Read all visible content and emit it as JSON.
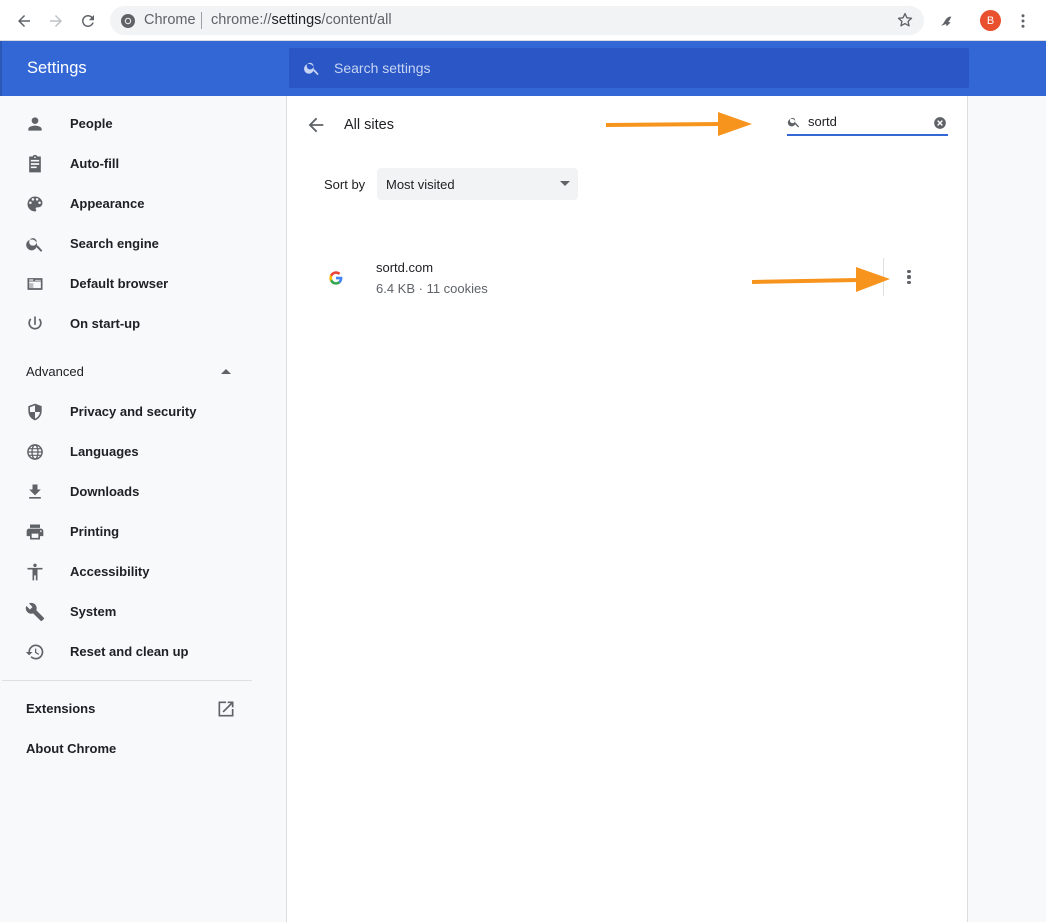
{
  "browser": {
    "omnibox_prefix": "Chrome",
    "url_scheme": "chrome://",
    "url_host": "settings",
    "url_path": "/content/all",
    "profile_initial": "B",
    "profile_color": "#e8502e"
  },
  "header": {
    "title": "Settings",
    "search_placeholder": "Search settings",
    "color": "#3367d6"
  },
  "sidebar": {
    "items": [
      {
        "label": "People",
        "icon": "person-icon"
      },
      {
        "label": "Auto-fill",
        "icon": "clipboard-icon"
      },
      {
        "label": "Appearance",
        "icon": "palette-icon"
      },
      {
        "label": "Search engine",
        "icon": "search-icon"
      },
      {
        "label": "Default browser",
        "icon": "browser-window-icon"
      },
      {
        "label": "On start-up",
        "icon": "power-icon"
      }
    ],
    "advanced_label": "Advanced",
    "advanced_items": [
      {
        "label": "Privacy and security",
        "icon": "shield-icon"
      },
      {
        "label": "Languages",
        "icon": "globe-icon"
      },
      {
        "label": "Downloads",
        "icon": "download-icon"
      },
      {
        "label": "Printing",
        "icon": "printer-icon"
      },
      {
        "label": "Accessibility",
        "icon": "accessibility-icon"
      },
      {
        "label": "System",
        "icon": "wrench-icon"
      },
      {
        "label": "Reset and clean up",
        "icon": "restore-icon"
      }
    ],
    "extensions_label": "Extensions",
    "about_label": "About Chrome"
  },
  "main": {
    "title": "All sites",
    "site_search_value": "sortd",
    "sort_label": "Sort by",
    "sort_value": "Most visited",
    "sites": [
      {
        "name": "sortd.com",
        "meta": "6.4 KB · 11 cookies",
        "favicon": "google-g-icon"
      }
    ]
  },
  "annotations": {
    "arrow_color": "#f7941d"
  }
}
